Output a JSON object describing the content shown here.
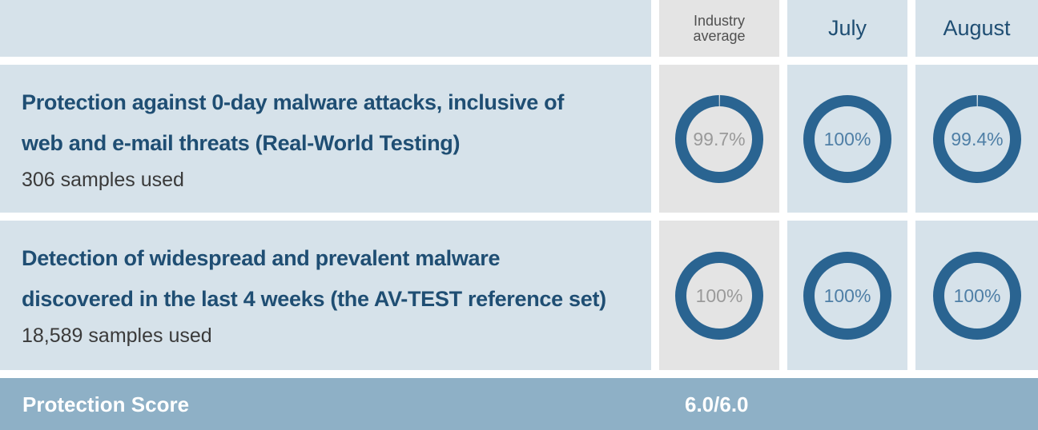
{
  "header": {
    "columns": [
      {
        "label_line1": "Industry",
        "label_line2": "average"
      },
      {
        "label": "July"
      },
      {
        "label": "August"
      }
    ]
  },
  "rows": [
    {
      "title_line1": "Protection against 0-day malware attacks, inclusive of",
      "title_line2": "web and e-mail threats (Real-World Testing)",
      "samples": "306 samples used",
      "values": [
        {
          "text": "99.7%",
          "percent": 99.7
        },
        {
          "text": "100%",
          "percent": 100
        },
        {
          "text": "99.4%",
          "percent": 99.4
        }
      ]
    },
    {
      "title_line1": "Detection of widespread and prevalent malware",
      "title_line2": "discovered in the last 4 weeks (the AV-TEST reference set)",
      "samples": "18,589 samples used",
      "values": [
        {
          "text": "100%",
          "percent": 100
        },
        {
          "text": "100%",
          "percent": 100
        },
        {
          "text": "100%",
          "percent": 100
        }
      ]
    }
  ],
  "footer": {
    "title": "Protection Score",
    "score": "6.0/6.0"
  },
  "colors": {
    "ring": "#2a6491",
    "ring_gap_blue": "#d6e2ea",
    "ring_gap_grey": "#e4e4e4",
    "text_industry": "#9a9a9a",
    "text_month": "#4f7fa6"
  }
}
